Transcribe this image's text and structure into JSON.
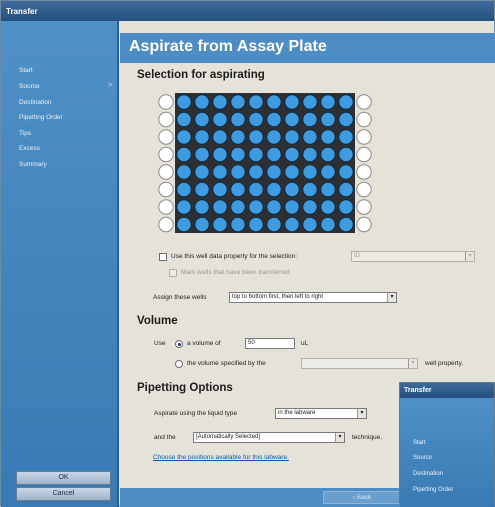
{
  "window": {
    "title": "Transfer"
  },
  "sidebar": {
    "items": [
      {
        "label": "Start"
      },
      {
        "label": "Source"
      },
      {
        "label": "Destination"
      },
      {
        "label": "Pipetting Order"
      },
      {
        "label": "Tips"
      },
      {
        "label": "Excess"
      },
      {
        "label": "Summary"
      }
    ],
    "arrow": ">",
    "ok_label": "OK",
    "cancel_label": "Cancel"
  },
  "header": {
    "title": "Aspirate from Assay Plate"
  },
  "selection": {
    "heading": "Selection for aspirating",
    "plate": {
      "rows": 8,
      "columns": 12,
      "selected_columns_from": 2,
      "selected_columns_to": 11,
      "selected_color": "#3f9be0",
      "empty_color": "#ffffff"
    },
    "use_property_label": "Use this well data property for the selection:",
    "use_property_value": "ID",
    "mark_transferred_label": "Mark wells that have been transferred",
    "assign_label": "Assign these wells",
    "assign_value": "top to bottom first, then left to right"
  },
  "volume": {
    "heading": "Volume",
    "use_label": "Use",
    "option1_label": "a volume of",
    "option1_value": "50",
    "unit": "uL",
    "option2_label": "the volume specified by the",
    "option2_suffix": "well property."
  },
  "pipetting": {
    "heading": "Pipetting Options",
    "liquid_label": "Aspirate using the liquid type",
    "liquid_value": "in the labware",
    "and_label": "and the",
    "technique_value": "[Automatically Selected]",
    "technique_suffix": "technique.",
    "link_text": "Choose the positions available for this labware."
  },
  "footer": {
    "back_label": "Back"
  },
  "second_window": {
    "title": "Transfer",
    "items": [
      {
        "label": "Start"
      },
      {
        "label": "Source"
      },
      {
        "label": "Destination"
      },
      {
        "label": "Pipetting Order"
      }
    ]
  }
}
